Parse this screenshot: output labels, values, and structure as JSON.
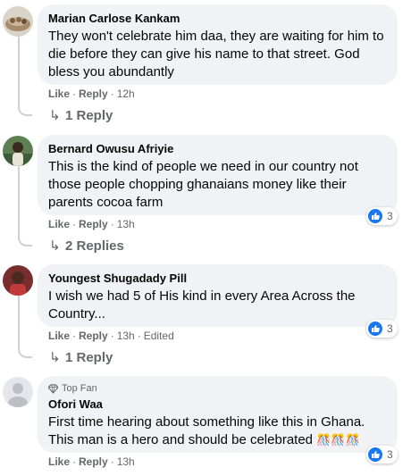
{
  "colors": {
    "accent": "#1877f2",
    "bubble": "#f0f2f5",
    "muted": "#65676b"
  },
  "comments": [
    {
      "author": "Marian Carlose Kankam",
      "lines": [
        "They won't celebrate him daa, they are waiting for him to",
        "die before they can give his name to that street. God",
        "bless you abundantly"
      ],
      "like_label": "Like",
      "reply_label": "Reply",
      "time": "12h",
      "replies_label": "1 Reply"
    },
    {
      "author": "Bernard Owusu Afriyie",
      "lines": [
        "This is the kind of people we need in our country not",
        "those people chopping ghanaians money like their",
        "parents cocoa farm"
      ],
      "like_label": "Like",
      "reply_label": "Reply",
      "time": "13h",
      "reaction_count": "3",
      "replies_label": "2 Replies"
    },
    {
      "author": "Youngest Shugadady Pill",
      "lines": [
        "I wish we had 5 of His kind in every Area Across the",
        "Country..."
      ],
      "like_label": "Like",
      "reply_label": "Reply",
      "time": "13h",
      "edited": "Edited",
      "reaction_count": "3",
      "replies_label": "1 Reply"
    },
    {
      "badge": "Top Fan",
      "author": "Ofori Waa",
      "lines": [
        "First time hearing about something like this in Ghana.",
        "This man is a hero and should be celebrated"
      ],
      "emoji": "🎊🎊🎊",
      "like_label": "Like",
      "reply_label": "Reply",
      "time": "13h",
      "reaction_count": "3"
    }
  ]
}
